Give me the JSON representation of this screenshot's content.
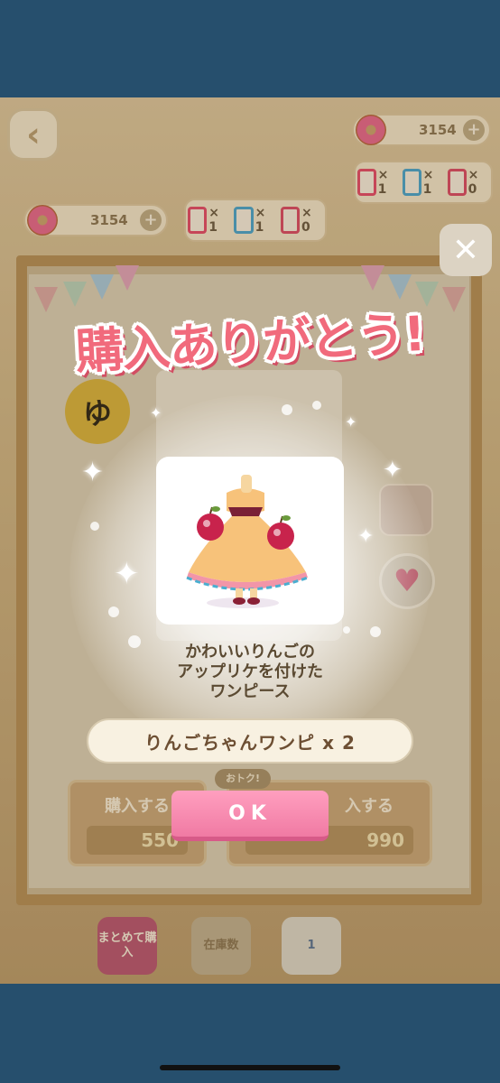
{
  "hud": {
    "donut_count_top": "3154",
    "donut_count_mid": "3154",
    "tickets": [
      {
        "color": "#e24b67",
        "count": "× 1"
      },
      {
        "color": "#4aa3c8",
        "count": "× 1"
      },
      {
        "color": "#d84b63",
        "count": "× 0"
      }
    ],
    "ticket_colors_mid": [
      "#e24b67",
      "#4aa3c8",
      "#d84b63"
    ],
    "ticket_counts_mid": [
      "× 1",
      "× 1",
      "× 0"
    ]
  },
  "background": {
    "badge_glyph": "ゆ",
    "otoku_label": "おトク!",
    "buy_left_label": "購入する",
    "buy_left_price": "550",
    "buy_right_label": "入する",
    "buy_right_price": "990",
    "bulk_buy_label": "まとめて購入",
    "stock_label": "在庫数",
    "like_count": "1"
  },
  "dialog": {
    "title": "購入ありがとう!",
    "item_description": [
      "かわいいりんごの",
      "アップリケを付けた",
      "ワンピース"
    ],
    "item_name_quantity": "りんごちゃんワンピ x 2",
    "ok_label": "OK"
  },
  "colors": {
    "status_bar": "#264f6d",
    "title_pink": "#f16a7c",
    "ok_button": "#f07aa3"
  }
}
